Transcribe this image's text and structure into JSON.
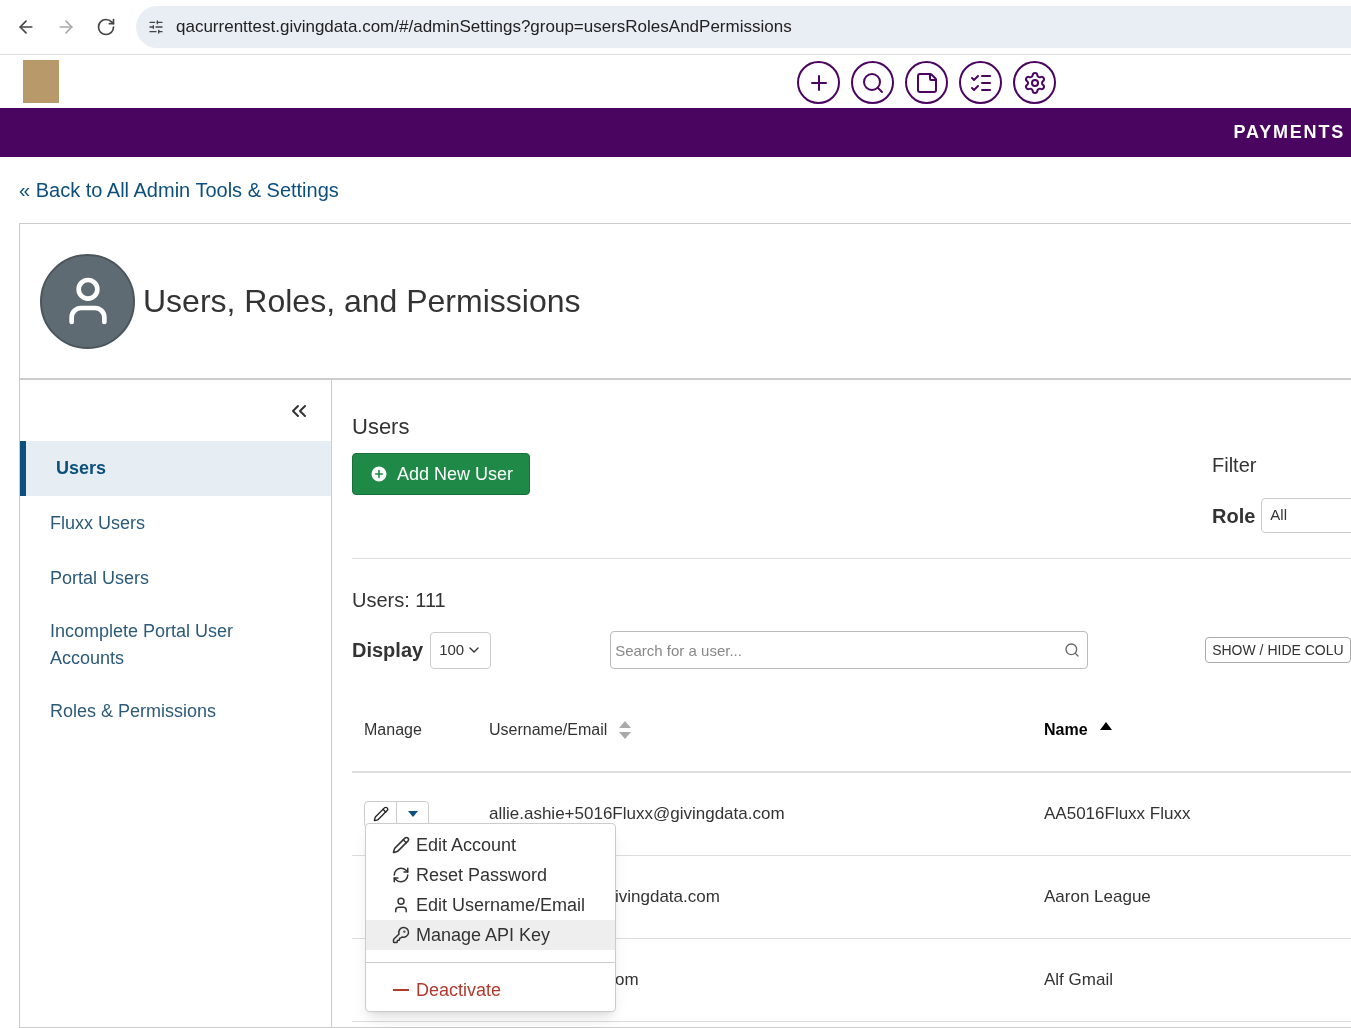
{
  "browser": {
    "url": "qacurrenttest.givingdata.com/#/adminSettings?group=usersRolesAndPermissions"
  },
  "header": {
    "nav_label": "PAYMENTS"
  },
  "back_link": "« Back to All Admin Tools & Settings",
  "page_title": "Users, Roles, and Permissions",
  "sidebar": {
    "items": [
      {
        "label": "Users",
        "selected": true
      },
      {
        "label": "Fluxx Users",
        "selected": false
      },
      {
        "label": "Portal Users",
        "selected": false
      },
      {
        "label": "Incomplete Portal User Accounts",
        "selected": false
      },
      {
        "label": "Roles & Permissions",
        "selected": false
      }
    ]
  },
  "users": {
    "title": "Users",
    "add_button": "Add New User",
    "filter": {
      "title": "Filter",
      "role_label": "Role",
      "role_value": "All"
    },
    "count": "Users: 111",
    "display_label": "Display",
    "display_value": "100",
    "search_placeholder": "Search for a user...",
    "columns_button": "SHOW / HIDE COLU",
    "columns": [
      {
        "label": "Manage",
        "sortable": false,
        "sorted": false
      },
      {
        "label": "Username/Email",
        "sortable": true,
        "sorted": false
      },
      {
        "label": "Name",
        "sortable": true,
        "sorted": true
      }
    ],
    "rows": [
      {
        "email": "allie.ashie+5016Fluxx@givingdata.com",
        "name": "AA5016Fluxx Fluxx",
        "manage_button": true
      },
      {
        "email": "ivingdata.com",
        "name": "Aaron League",
        "manage_button": false
      },
      {
        "email": "om",
        "name": "Alf Gmail",
        "manage_button": false
      }
    ],
    "manage_menu": {
      "items": [
        {
          "label": "Edit Account",
          "kind": "action",
          "highlighted": false
        },
        {
          "label": "Reset Password",
          "kind": "action",
          "highlighted": false
        },
        {
          "label": "Edit Username/Email",
          "kind": "action",
          "highlighted": false
        },
        {
          "label": "Manage API Key",
          "kind": "action",
          "highlighted": true
        },
        {
          "label": "Deactivate",
          "kind": "danger",
          "highlighted": false
        }
      ]
    }
  }
}
